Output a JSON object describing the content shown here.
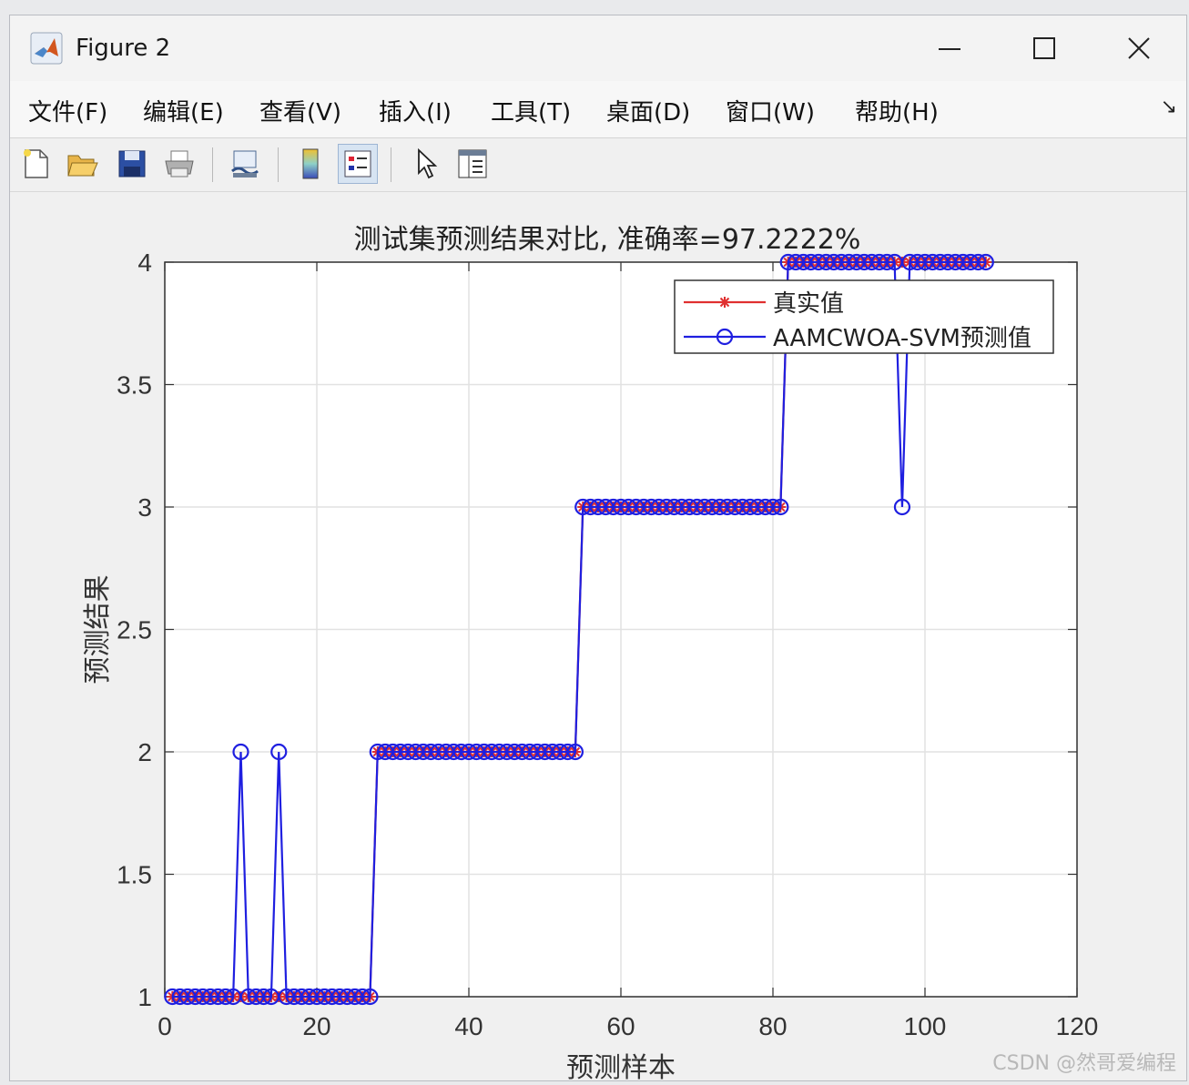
{
  "window": {
    "title": "Figure 2"
  },
  "menu": {
    "items": [
      "文件(F)",
      "编辑(E)",
      "查看(V)",
      "插入(I)",
      "工具(T)",
      "桌面(D)",
      "窗口(W)",
      "帮助(H)"
    ],
    "arrow": "↘"
  },
  "toolbar": {
    "icons": [
      "new-figure-icon",
      "open-file-icon",
      "save-icon",
      "print-icon",
      "link-plot-icon",
      "colorbar-icon",
      "legend-icon",
      "select-pointer-icon",
      "property-inspector-icon"
    ]
  },
  "chart_data": {
    "type": "line",
    "title": "测试集预测结果对比, 准确率=97.2222%",
    "xlabel": "预测样本",
    "ylabel": "预测结果",
    "xlim": [
      0,
      120
    ],
    "ylim": [
      1,
      4
    ],
    "xticks": [
      0,
      20,
      40,
      60,
      80,
      100,
      120
    ],
    "yticks": [
      1,
      1.5,
      2,
      2.5,
      3,
      3.5,
      4
    ],
    "grid": true,
    "legend_position": "top-right",
    "series": [
      {
        "name": "真实值",
        "color": "#e03030",
        "marker": "star",
        "values": [
          1,
          1,
          1,
          1,
          1,
          1,
          1,
          1,
          1,
          1,
          1,
          1,
          1,
          1,
          1,
          1,
          1,
          1,
          1,
          1,
          1,
          1,
          1,
          1,
          1,
          1,
          1,
          2,
          2,
          2,
          2,
          2,
          2,
          2,
          2,
          2,
          2,
          2,
          2,
          2,
          2,
          2,
          2,
          2,
          2,
          2,
          2,
          2,
          2,
          2,
          2,
          2,
          2,
          2,
          3,
          3,
          3,
          3,
          3,
          3,
          3,
          3,
          3,
          3,
          3,
          3,
          3,
          3,
          3,
          3,
          3,
          3,
          3,
          3,
          3,
          3,
          3,
          3,
          3,
          3,
          3,
          4,
          4,
          4,
          4,
          4,
          4,
          4,
          4,
          4,
          4,
          4,
          4,
          4,
          4,
          4,
          4,
          4,
          4,
          4,
          4,
          4,
          4,
          4,
          4,
          4,
          4,
          4
        ]
      },
      {
        "name": "AAMCWOA-SVM预测值",
        "color": "#1f1fe0",
        "marker": "circle",
        "values": [
          1,
          1,
          1,
          1,
          1,
          1,
          1,
          1,
          1,
          2,
          1,
          1,
          1,
          1,
          2,
          1,
          1,
          1,
          1,
          1,
          1,
          1,
          1,
          1,
          1,
          1,
          1,
          2,
          2,
          2,
          2,
          2,
          2,
          2,
          2,
          2,
          2,
          2,
          2,
          2,
          2,
          2,
          2,
          2,
          2,
          2,
          2,
          2,
          2,
          2,
          2,
          2,
          2,
          2,
          3,
          3,
          3,
          3,
          3,
          3,
          3,
          3,
          3,
          3,
          3,
          3,
          3,
          3,
          3,
          3,
          3,
          3,
          3,
          3,
          3,
          3,
          3,
          3,
          3,
          3,
          3,
          4,
          4,
          4,
          4,
          4,
          4,
          4,
          4,
          4,
          4,
          4,
          4,
          4,
          4,
          4,
          3,
          4,
          4,
          4,
          4,
          4,
          4,
          4,
          4,
          4,
          4,
          4
        ]
      }
    ]
  },
  "watermark": "CSDN @然哥爱编程"
}
